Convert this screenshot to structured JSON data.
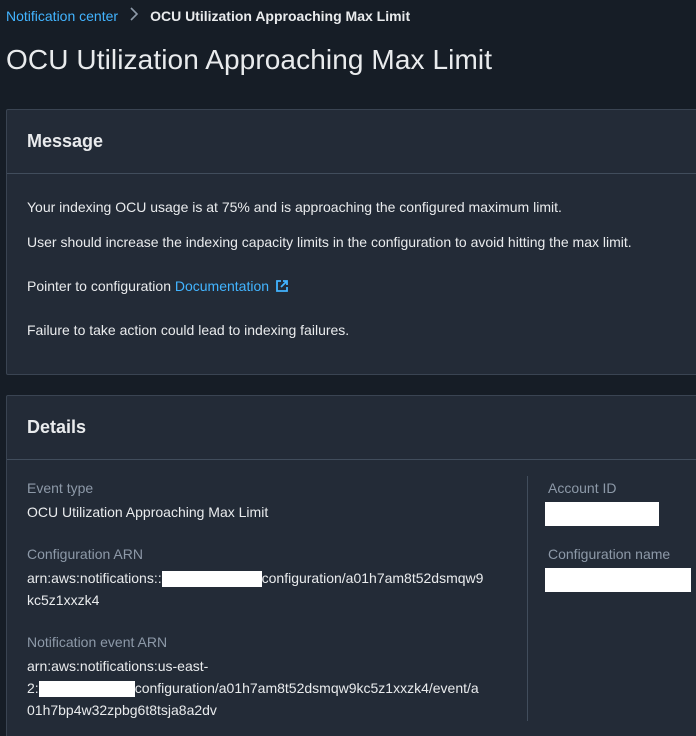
{
  "breadcrumb": {
    "parent": "Notification center",
    "current": "OCU Utilization Approaching Max Limit"
  },
  "page_title": "OCU Utilization Approaching Max Limit",
  "message": {
    "heading": "Message",
    "line1": "Your indexing OCU usage is at 75% and is approaching the configured maximum limit.",
    "line2": "User should increase the indexing capacity limits in the configuration to avoid hitting the max limit.",
    "pointer_prefix": "Pointer to configuration ",
    "doc_link": "Documentation",
    "line4": "Failure to take action could lead to indexing failures."
  },
  "details": {
    "heading": "Details",
    "event_type_label": "Event type",
    "event_type_value": "OCU Utilization Approaching Max Limit",
    "config_arn_label": "Configuration ARN",
    "config_arn_prefix": "arn:aws:notifications::",
    "config_arn_suffix": "configuration/a01h7am8t52dsmqw9",
    "config_arn_line2": "kc5z1xxzk4",
    "event_arn_label": "Notification event ARN",
    "event_arn_line1": "arn:aws:notifications:us-east-",
    "event_arn_line2_prefix": "2:",
    "event_arn_line2_suffix": "configuration/a01h7am8t52dsmqw9kc5z1xxzk4/event/a",
    "event_arn_line3": "01h7bp4w32zpbg6t8tsja8a2dv",
    "account_id_label": "Account ID",
    "config_name_label": "Configuration name"
  },
  "colors": {
    "link": "#42b4ff",
    "background": "#161d26",
    "panel": "#232b37"
  },
  "icons": {
    "breadcrumb_separator": "chevron-right-icon",
    "external_link": "external-link-icon"
  }
}
